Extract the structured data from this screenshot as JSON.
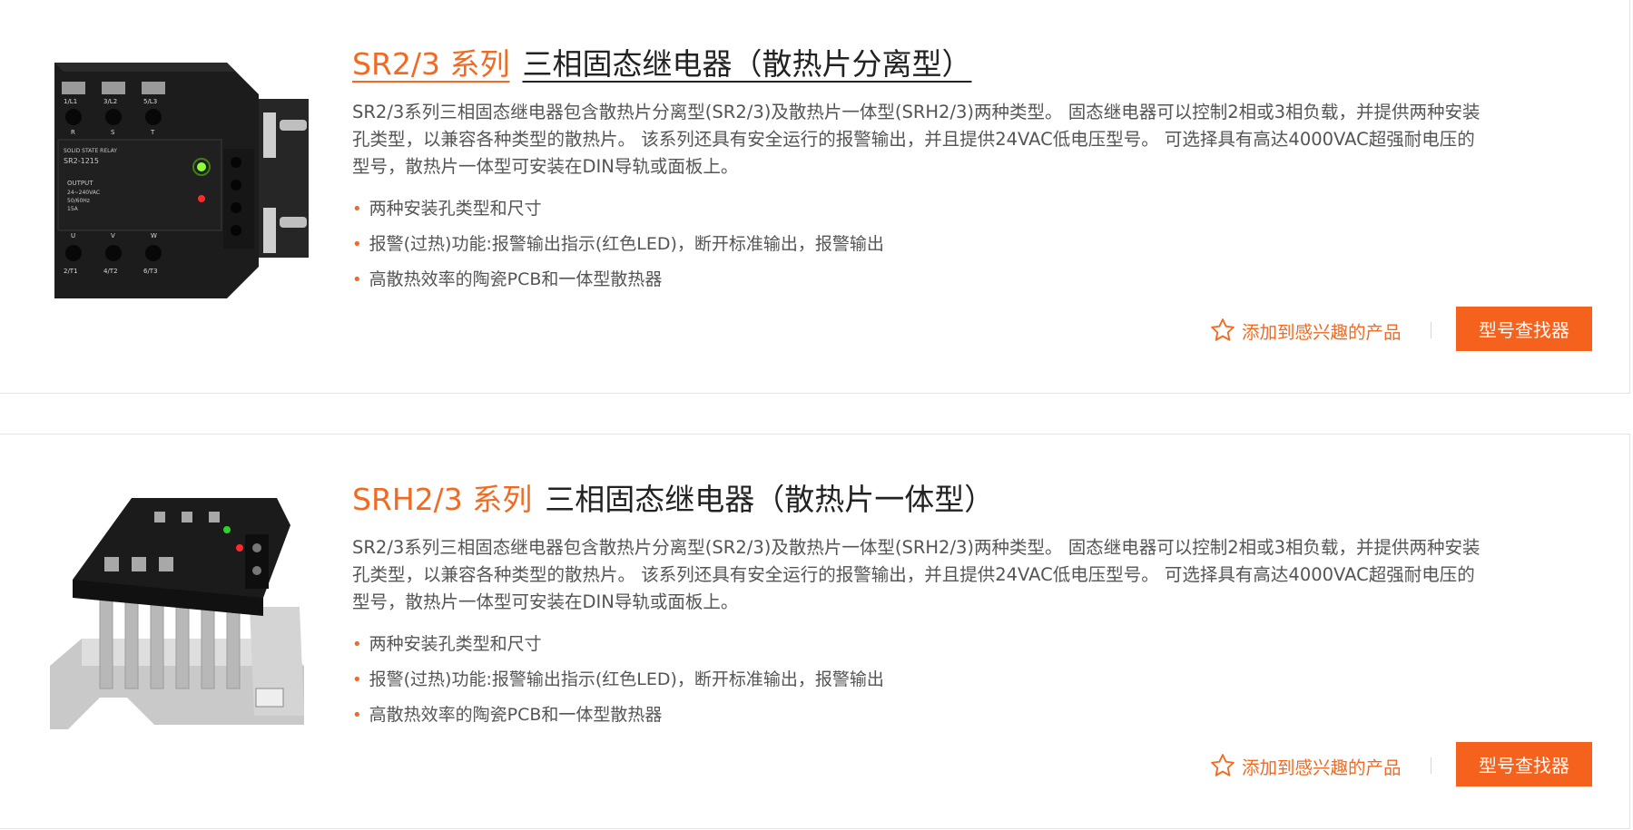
{
  "products": [
    {
      "series": "SR2/3 系列",
      "name": "三相固态继电器（散热片分离型）",
      "description": "SR2/3系列三相固态继电器包含散热片分离型(SR2/3)及散热片一体型(SRH2/3)两种类型。 固态继电器可以控制2相或3相负载，并提供两种安装孔类型，以兼容各种类型的散热片。 该系列还具有安全运行的报警输出，并且提供24VAC低电压型号。 可选择具有高达4000VAC超强耐电压的型号，散热片一体型可安装在DIN导轨或面板上。",
      "features": [
        "两种安装孔类型和尺寸",
        "报警(过热)功能:报警输出指示(红色LED)，断开标准输出，报警输出",
        "高散热效率的陶瓷PCB和一体型散热器"
      ],
      "favorite_label": "添加到感兴趣的产品",
      "finder_label": "型号查找器",
      "image_labels": {
        "terminals_top": [
          "1/L1",
          "3/L2",
          "5/L3"
        ],
        "terminals_top_letters": [
          "R",
          "S",
          "T"
        ],
        "model_lines": [
          "SOLID STATE RELAY",
          "SR2-1215"
        ],
        "output_lines": [
          "OUTPUT",
          "24~240VAC",
          "50/60Hz",
          "15A"
        ],
        "terminals_bottom_letters": [
          "U",
          "V",
          "W"
        ],
        "terminals_bottom": [
          "2/T1",
          "4/T2",
          "6/T3"
        ]
      }
    },
    {
      "series": "SRH2/3 系列",
      "name": "三相固态继电器（散热片一体型）",
      "description": "SR2/3系列三相固态继电器包含散热片分离型(SR2/3)及散热片一体型(SRH2/3)两种类型。 固态继电器可以控制2相或3相负载，并提供两种安装孔类型，以兼容各种类型的散热片。 该系列还具有安全运行的报警输出，并且提供24VAC低电压型号。 可选择具有高达4000VAC超强耐电压的型号，散热片一体型可安装在DIN导轨或面板上。",
      "features": [
        "两种安装孔类型和尺寸",
        "报警(过热)功能:报警输出指示(红色LED)，断开标准输出，报警输出",
        "高散热效率的陶瓷PCB和一体型散热器"
      ],
      "favorite_label": "添加到感兴趣的产品",
      "finder_label": "型号查找器"
    }
  ],
  "colors": {
    "accent": "#f26a21",
    "button": "#f4621e",
    "text": "#555555"
  },
  "icons": {
    "favorite": "star-outline-icon",
    "bullet": "dot-icon"
  }
}
